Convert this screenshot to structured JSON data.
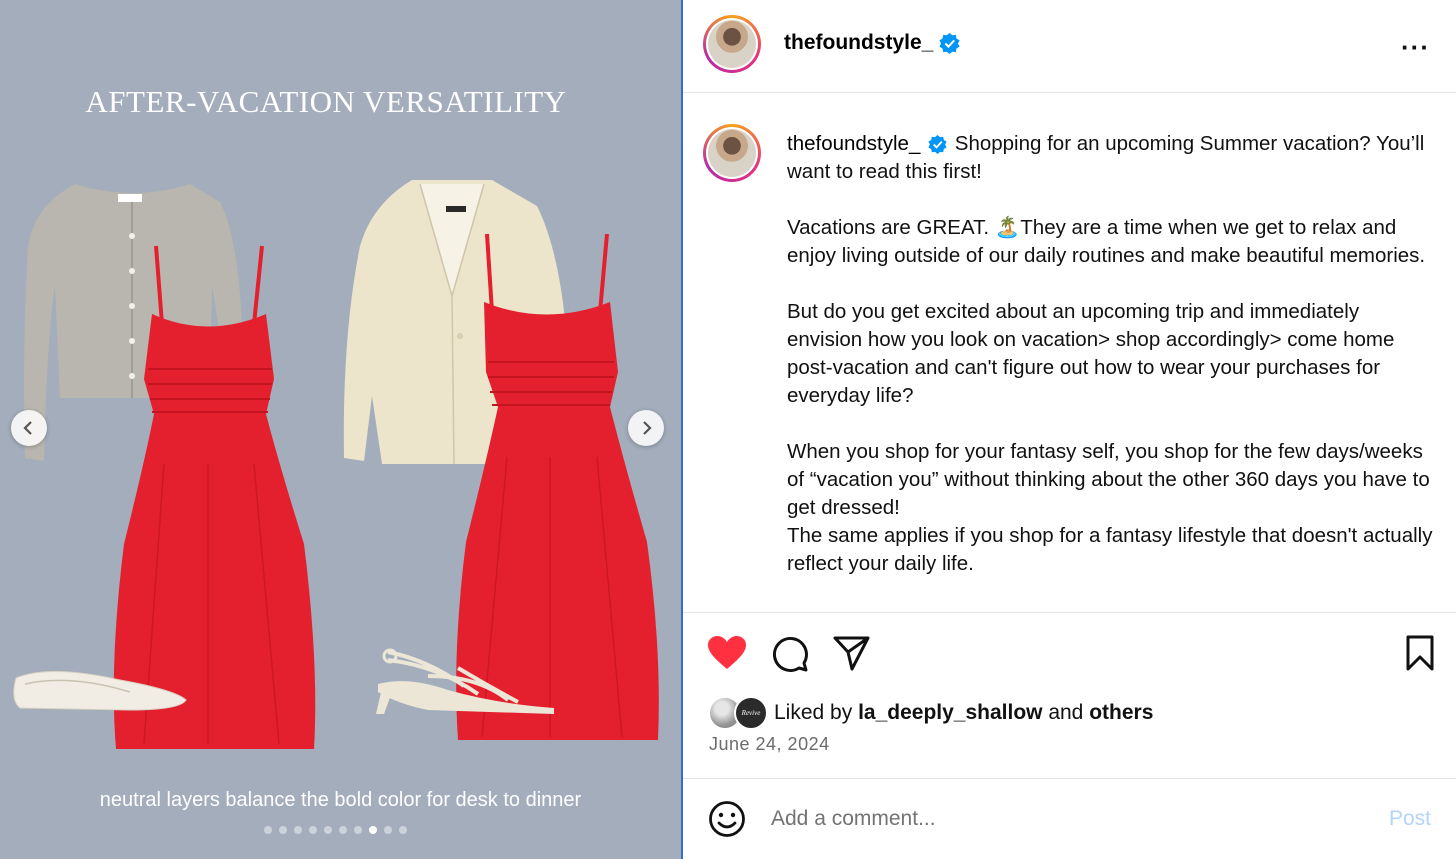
{
  "slide": {
    "title": "AFTER-VACATION VERSATILITY",
    "caption": "neutral layers balance the bold color for desk to dinner",
    "dots_total": 10,
    "dots_active_index": 7
  },
  "header": {
    "username": "thefoundstyle_",
    "verified": true
  },
  "post": {
    "username": "thefoundstyle_",
    "paragraphs": [
      "Shopping for an upcoming Summer vacation? You’ll want to read this first!",
      "Vacations are GREAT. 🏝️They are a time when we get to relax and enjoy living outside of our daily routines and make beautiful memories.",
      "But do you get excited about an upcoming trip and immediately envision how you look on vacation> shop accordingly> come home post-vacation and can't figure out how to wear your purchases for everyday life?",
      "When you shop for your fantasy self, you shop for the few days/weeks of “vacation you” without thinking about the other 360 days you have to get dressed!",
      "The same applies if you shop for a fantasy lifestyle that doesn't actually reflect your daily life."
    ]
  },
  "likes": {
    "prefix": "Liked by",
    "user": "la_deeply_shallow",
    "conj": "and",
    "others": "others",
    "avatar2_text": "Revive"
  },
  "date": "June 24, 2024",
  "comment": {
    "placeholder": "Add a comment...",
    "post_label": "Post"
  },
  "colors": {
    "like_red": "#ff3040",
    "verified_blue": "#0095f6",
    "dress_red": "#e5202e",
    "slide_bg": "#a3adbb"
  }
}
